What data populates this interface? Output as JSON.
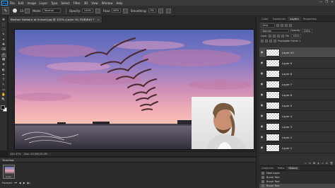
{
  "menubar": {
    "logo": "Ps",
    "items": [
      "File",
      "Edit",
      "Image",
      "Layer",
      "Type",
      "Select",
      "Filter",
      "3D",
      "View",
      "Window",
      "Help"
    ],
    "window_controls": [
      "—",
      "❐",
      "✕"
    ]
  },
  "options": {
    "brush_size": "13",
    "mode_label": "Mode:",
    "mode_value": "Normal",
    "opacity_label": "Opacity:",
    "opacity_value": "100%",
    "flow_label": "Flow:",
    "flow_value": "80%",
    "smoothing_label": "Smoothing:",
    "smoothing_value": "0%"
  },
  "document": {
    "tab_title": "Beshan Harbour at Sunset.jpg @ 142% (Layer 10, RGB/8#) *",
    "close": "×",
    "status_zoom": "142.37%",
    "status_doc": "Doc: 20.0M/29.0M"
  },
  "timeline": {
    "title": "Timeline",
    "frame_time": "0 sec.",
    "loop": "Forever"
  },
  "panels": {
    "top_tabs": [
      "Color",
      "Swatches",
      "Layers",
      "Properties"
    ],
    "active_top_tab": "Layers",
    "kind_label": "Kind",
    "blend_mode": "Normal",
    "opacity_label": "Opacity:",
    "opacity_value": "100%",
    "lock_label": "Lock:",
    "fill_label": "Fill:",
    "fill_value": "100%",
    "propagate_label": "Propagate Frame 1"
  },
  "layers": [
    {
      "name": "Layer 10",
      "selected": true
    },
    {
      "name": "Layer 9",
      "selected": false
    },
    {
      "name": "Layer 8",
      "selected": false
    },
    {
      "name": "Layer 7",
      "selected": false
    },
    {
      "name": "Layer 6",
      "selected": false
    },
    {
      "name": "Layer 5",
      "selected": false
    },
    {
      "name": "Layer 4",
      "selected": false
    },
    {
      "name": "Layer 3",
      "selected": false
    },
    {
      "name": "Layer 2",
      "selected": false
    },
    {
      "name": "Layer 1",
      "selected": false
    }
  ],
  "history": {
    "tabs": [
      "Channels",
      "Paths",
      "History"
    ],
    "active_tab": "History",
    "items": [
      "New Layer",
      "Brush Tool",
      "Brush Tool",
      "Brush Tool"
    ]
  },
  "tools": [
    "✥",
    "⬚",
    "◌",
    "✎",
    "⌖",
    "✚",
    "⌫",
    "✐",
    "▩",
    "◈",
    "◐",
    "✒",
    "T",
    "↖",
    "▭",
    "✋",
    "🔍"
  ]
}
